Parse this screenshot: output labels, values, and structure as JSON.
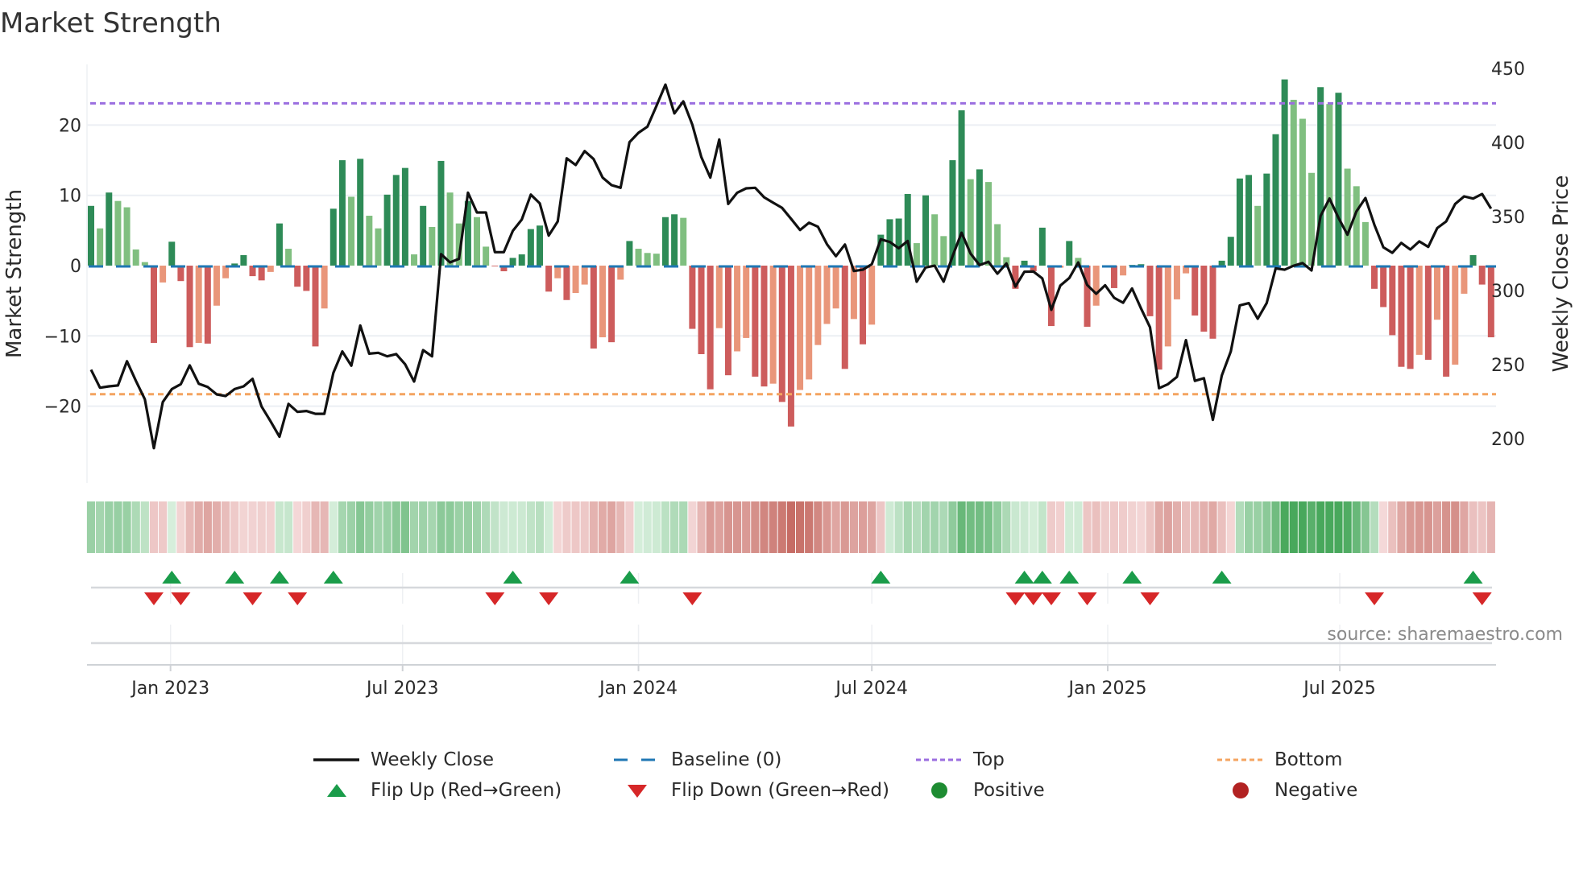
{
  "title": "Market Strength",
  "source_note": "source: sharemaestro.com",
  "colors": {
    "pos_strong": "#2e8b57",
    "pos_weak": "#80bf80",
    "neg_strong": "#cd5c5c",
    "neg_weak": "#e9967a",
    "baseline": "#1f77b4",
    "top": "#9b6ee0",
    "bottom": "#f4a460",
    "price": "#111111",
    "flip_up": "#1a9c4a",
    "flip_down": "#d62728",
    "positive": "#1e8c32",
    "negative": "#b22222"
  },
  "legend": [
    {
      "label": "Weekly Close",
      "icon": "solid-line"
    },
    {
      "label": "Baseline (0)",
      "icon": "dashed-line"
    },
    {
      "label": "Top",
      "icon": "dotted-line"
    },
    {
      "label": "Bottom",
      "icon": "dotted-line"
    },
    {
      "label": "Flip Up (Red→Green)",
      "icon": "triangle-up"
    },
    {
      "label": "Flip Down (Green→Red)",
      "icon": "triangle-down"
    },
    {
      "label": "Positive",
      "icon": "circle"
    },
    {
      "label": "Negative",
      "icon": "circle"
    }
  ],
  "chart_data": {
    "type": "bar+line",
    "title": "Market Strength",
    "ylabel_left": "Market Strength",
    "ylabel_right": "Weekly Close Price",
    "ylim_left": [
      -29.5,
      29.8
    ],
    "ylim_right": [
      186,
      461
    ],
    "left_ticks": [
      {
        "v": 20,
        "label": "20"
      },
      {
        "v": 10,
        "label": "10"
      },
      {
        "v": 0,
        "label": "0"
      },
      {
        "v": -10,
        "label": "−10"
      },
      {
        "v": -20,
        "label": "−20"
      }
    ],
    "right_ticks": [
      {
        "v": 450,
        "label": "450"
      },
      {
        "v": 400,
        "label": "400"
      },
      {
        "v": 350,
        "label": "350"
      },
      {
        "v": 300,
        "label": "300"
      },
      {
        "v": 250,
        "label": "250"
      },
      {
        "v": 200,
        "label": "200"
      }
    ],
    "x_ticks": [
      {
        "date": "2023-01-01",
        "label": "Jan 2023"
      },
      {
        "date": "2023-07-01",
        "label": "Jul 2023"
      },
      {
        "date": "2024-01-01",
        "label": "Jan 2024"
      },
      {
        "date": "2024-07-01",
        "label": "Jul 2024"
      },
      {
        "date": "2025-01-01",
        "label": "Jan 2025"
      },
      {
        "date": "2025-07-01",
        "label": "Jul 2025"
      }
    ],
    "start_date": "2022-10-31",
    "end_date": "2025-10-20",
    "interval_days": 7,
    "top_level": 23.1,
    "bottom_level": -18.3,
    "grid": true,
    "legend_position": "bottom",
    "strength": [
      8.5,
      5.3,
      10.4,
      9.2,
      8.3,
      2.3,
      0.5,
      -11,
      -2.4,
      3.4,
      -2.2,
      -11.6,
      -11,
      -11.1,
      -5.7,
      -1.8,
      0.3,
      1.5,
      -1.5,
      -2.1,
      -0.9,
      6.0,
      2.4,
      -3,
      -3.6,
      -11.5,
      -6.1,
      8.1,
      15,
      9.8,
      15.2,
      7.1,
      5.3,
      10.1,
      12.9,
      13.9,
      1.6,
      8.5,
      5.5,
      14.9,
      10.4,
      6.0,
      9.2,
      6.9,
      2.7,
      -0.1,
      -0.8,
      1.1,
      1.6,
      5.2,
      5.7,
      -3.7,
      -1.8,
      -4.9,
      -3.9,
      -2.7,
      -11.8,
      -10.2,
      -10.9,
      -2,
      3.5,
      2.4,
      1.8,
      1.7,
      6.9,
      7.3,
      6.8,
      -9,
      -12.6,
      -17.6,
      -8.9,
      -15.6,
      -12.2,
      -10.3,
      -15.8,
      -17.2,
      -16.8,
      -19.4,
      -22.9,
      -17.7,
      -16.2,
      -11.3,
      -8.3,
      -6.1,
      -14.7,
      -7.6,
      -11.2,
      -8.4,
      4.4,
      6.6,
      6.7,
      10.2,
      3.2,
      10,
      7.3,
      4.2,
      15,
      22.1,
      12.3,
      13.7,
      11.9,
      5.9,
      1.2,
      -3.3,
      0.7,
      -0.8,
      5.4,
      -8.6,
      -0.3,
      3.5,
      1.1,
      -8.7,
      -5.7,
      -0.1,
      -3.2,
      -1.4,
      0.1,
      0.2,
      -7.2,
      -14.8,
      -11.5,
      -4.8,
      -1.1,
      -7.1,
      -9.4,
      -10.4,
      0.7,
      4.1,
      12.4,
      12.9,
      8.5,
      13.1,
      18.7,
      26.5,
      23.6,
      20.9,
      13.2,
      25.4,
      23,
      24.6,
      13.8,
      11.3,
      6.2,
      -3.3,
      -5.9,
      -9.9,
      -14.4,
      -14.7,
      -12.7,
      -13.4,
      -7.7,
      -15.8,
      -14.1,
      -4,
      1.5,
      -2.7,
      -10.2
    ],
    "weekly_close": [
      246.6,
      234.4,
      235.3,
      235.9,
      252.3,
      239,
      226.6,
      193.6,
      224.8,
      233.5,
      236.8,
      249.5,
      237.1,
      234.9,
      229.9,
      228.8,
      233.5,
      235.3,
      240.4,
      221.7,
      211.8,
      201.3,
      223.5,
      218.1,
      218.7,
      216.8,
      216.8,
      244.4,
      258.9,
      249.3,
      276.4,
      257.4,
      258,
      255.6,
      257.1,
      250.2,
      238.6,
      259.8,
      255.6,
      324.6,
      319,
      321.4,
      366.1,
      352.7,
      352.7,
      325.9,
      325.9,
      340.4,
      348,
      364.8,
      358.9,
      337.1,
      346.7,
      389.3,
      384.8,
      394.2,
      388.8,
      376.3,
      371.2,
      369.4,
      400.2,
      406.5,
      410.7,
      424.6,
      439.1,
      419.6,
      427.7,
      412,
      390.2,
      376.3,
      402,
      358.5,
      366.1,
      369,
      369.4,
      363,
      359.4,
      355.8,
      348.5,
      340.9,
      345.8,
      343.1,
      331.3,
      323.2,
      331.1,
      313.2,
      314.1,
      317.8,
      334.6,
      332.8,
      328.6,
      333.5,
      306,
      315.6,
      316.8,
      306,
      323.2,
      339.1,
      325,
      317.2,
      319.4,
      311.4,
      318.3,
      302.7,
      312.7,
      312.9,
      308.2,
      287,
      303.3,
      308.5,
      319,
      303.8,
      297.8,
      303.6,
      295.1,
      291.8,
      301.4,
      287.9,
      275.2,
      234.1,
      236.8,
      241.7,
      266.5,
      239,
      240.8,
      212.7,
      242.6,
      258.9,
      290,
      291.5,
      281,
      291.5,
      315,
      314.1,
      316.8,
      318.6,
      313.6,
      350.4,
      362.1,
      349.1,
      337.7,
      353.4,
      362.5,
      344.4,
      329.2,
      325.5,
      332.2,
      327.7,
      333.2,
      329.5,
      342.2,
      346.7,
      358.5,
      363.6,
      362.1,
      365.2,
      355.3
    ]
  }
}
